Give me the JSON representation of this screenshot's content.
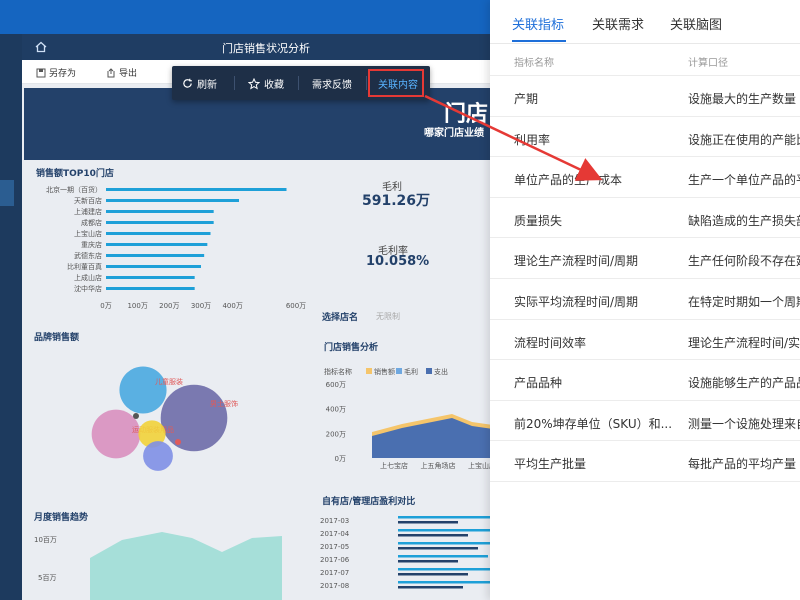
{
  "header": {
    "title": "门店销售状况分析"
  },
  "toolbar": {
    "save_as": "另存为",
    "export": "导出"
  },
  "popup": {
    "refresh": "刷新",
    "favorite": "收藏",
    "feedback": "需求反馈",
    "related": "关联内容"
  },
  "banner": {
    "title": "门店",
    "subtitle": "哪家门店业绩"
  },
  "sections": {
    "top10": "销售额TOP10门店",
    "brand": "品牌销售额",
    "monthly": "月度销售趋势",
    "store_select": "选择店名",
    "store_select_value": "无限制",
    "store_analysis": "门店销售分析",
    "profit_compare": "自有店/管理店盈利对比"
  },
  "kpi": {
    "gross_label": "毛利",
    "gross_value": "591.26万",
    "rate_label": "毛利率",
    "rate_value": "10.058%"
  },
  "chart_data": [
    {
      "type": "bar",
      "title": "销售额TOP10门店",
      "categories": [
        "北京一期（百货）",
        "天新百店",
        "上浦建店",
        "成都店",
        "上宝山店",
        "重庆店",
        "武德东店",
        "比利董百真",
        "上成山店",
        "沈中华店"
      ],
      "values": [
        570,
        420,
        340,
        340,
        330,
        320,
        310,
        300,
        280,
        280
      ],
      "xticks": [
        "0万",
        "100万",
        "200万",
        "300万",
        "400万",
        "600万"
      ],
      "color": "#1ea0d8"
    },
    {
      "type": "scatter",
      "title": "品牌销售额",
      "bubbles": [
        {
          "label": "儿童服装",
          "value": 30,
          "color": "#4aa8e0"
        },
        {
          "label": "男士服饰",
          "value": 60,
          "color": "#6e6ba8"
        },
        {
          "label": "运动服装用品",
          "value": 32,
          "color": "#d98fbf"
        },
        {
          "label": "",
          "value": 10,
          "color": "#f2d13a"
        },
        {
          "label": "",
          "value": 12,
          "color": "#7f8fe6"
        }
      ]
    },
    {
      "type": "area",
      "title": "门店销售分析",
      "legend_title": "指标名称",
      "legend": [
        {
          "name": "销售额",
          "color": "#f5c56b"
        },
        {
          "name": "毛利",
          "color": "#6fa8e0"
        },
        {
          "name": "支出",
          "color": "#4a6fb0"
        }
      ],
      "categories": [
        "上七宝店",
        "上五角场店",
        "上宝山店"
      ],
      "yticks": [
        "0万",
        "200万",
        "400万",
        "600万"
      ]
    },
    {
      "type": "area",
      "title": "月度销售趋势",
      "yticks": [
        "5百万",
        "10百万"
      ]
    },
    {
      "type": "bar",
      "title": "自有店/管理店盈利对比",
      "categories": [
        "2017-03",
        "2017-04",
        "2017-05",
        "2017-06",
        "2017-07",
        "2017-08"
      ]
    }
  ],
  "panel": {
    "tabs": [
      "关联指标",
      "关联需求",
      "关联脑图"
    ],
    "col_name": "指标名称",
    "col_calc": "计算口径",
    "rows": [
      {
        "name": "产期",
        "calc": "设施最大的生产数量"
      },
      {
        "name": "利用率",
        "calc": "设施正在使用的产能比"
      },
      {
        "name": "单位产品的生产成本",
        "calc": "生产一个单位产品的平"
      },
      {
        "name": "质量损失",
        "calc": "缺陷造成的生产损失部"
      },
      {
        "name": "理论生产流程时间/周期",
        "calc": "生产任何阶段不存在延"
      },
      {
        "name": "实际平均流程时间/周期",
        "calc": "在特定时期如一个周期"
      },
      {
        "name": "流程时间效率",
        "calc": "理论生产流程时间/实"
      },
      {
        "name": "产品品种",
        "calc": "设施能够生产的产品品"
      },
      {
        "name": "前20%坤存单位（SKU）和...",
        "calc": "测量一个设施处理来自"
      },
      {
        "name": "平均生产批量",
        "calc": "每批产品的平均产量"
      }
    ]
  }
}
